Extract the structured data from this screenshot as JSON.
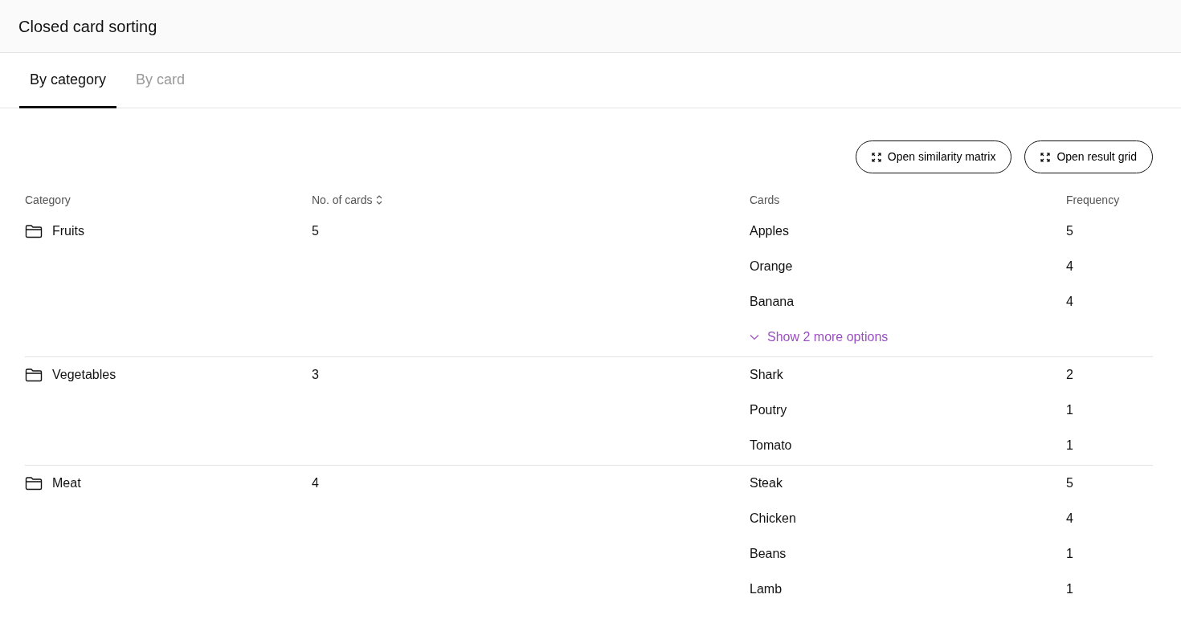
{
  "header": {
    "title": "Closed card sorting"
  },
  "tabs": [
    {
      "label": "By category",
      "selected": true
    },
    {
      "label": "By card",
      "selected": false
    }
  ],
  "actions": [
    {
      "label": "Open similarity matrix"
    },
    {
      "label": "Open result grid"
    }
  ],
  "table": {
    "columns": [
      {
        "label": "Category",
        "sortable": false
      },
      {
        "label": "No. of cards",
        "sortable": true
      },
      {
        "label": "Cards",
        "sortable": false
      },
      {
        "label": "Frequency",
        "sortable": false
      }
    ],
    "rows": [
      {
        "category": "Fruits",
        "count": "5",
        "cards": [
          {
            "name": "Apples",
            "frequency": "5"
          },
          {
            "name": "Orange",
            "frequency": "4"
          },
          {
            "name": "Banana",
            "frequency": "4"
          }
        ],
        "more_link": "Show 2 more options"
      },
      {
        "category": "Vegetables",
        "count": "3",
        "cards": [
          {
            "name": "Shark",
            "frequency": "2"
          },
          {
            "name": "Poutry",
            "frequency": "1"
          },
          {
            "name": "Tomato",
            "frequency": "1"
          }
        ]
      },
      {
        "category": "Meat",
        "count": "4",
        "cards": [
          {
            "name": "Steak",
            "frequency": "5"
          },
          {
            "name": "Chicken",
            "frequency": "4"
          },
          {
            "name": "Beans",
            "frequency": "1"
          },
          {
            "name": "Lamb",
            "frequency": "1"
          }
        ]
      }
    ]
  }
}
